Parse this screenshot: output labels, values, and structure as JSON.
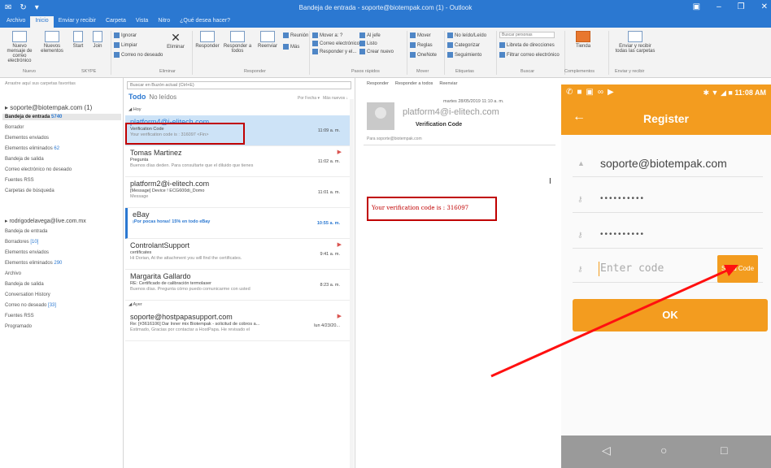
{
  "window": {
    "title": "Bandeja de entrada - soporte@biotempak.com (1) - Outlook",
    "qat_icons": [
      "outlook-icon",
      "send-receive-icon",
      "dropdown-icon"
    ],
    "controls": [
      "ribbon-display-icon",
      "minimize-icon",
      "maximize-icon",
      "close-icon"
    ]
  },
  "tabs": [
    "Archivo",
    "Inicio",
    "Enviar y recibir",
    "Carpeta",
    "Vista",
    "Nitro",
    "¿Qué desea hacer?"
  ],
  "ribbon": {
    "nuevo": {
      "new_email": "Nuevo mensaje de correo electrónico",
      "new_items": "Nuevos elementos",
      "group": "Nuevo"
    },
    "eliminar": {
      "ignore": "Ignorar",
      "clean": "Limpiar",
      "junk": "Correo no deseado",
      "delete": "Eliminar",
      "group": "Eliminar"
    },
    "skype": {
      "start": "Start",
      "join": "Join",
      "group": "SKYPE"
    },
    "responder": {
      "reply": "Responder",
      "reply_all": "Responder a todos",
      "forward": "Reenviar",
      "meeting": "Reunión",
      "more": "Más",
      "group": "Responder"
    },
    "quick_steps": {
      "move_to": "Mover a: ?",
      "to_manager": "Al jefe",
      "team_email": "Correo electrónico...",
      "done": "Listo",
      "reply_delete": "Responder y el...",
      "create_new": "Crear nuevo",
      "group": "Pasos rápidos"
    },
    "mover": {
      "move": "Mover",
      "rules": "Reglas",
      "onenote": "OneNote",
      "group": "Mover"
    },
    "etiquetas": {
      "unread": "No leído/Leído",
      "categorize": "Categorizar",
      "follow_up": "Seguimiento",
      "group": "Etiquetas"
    },
    "buscar": {
      "search_people_placeholder": "Buscar personas",
      "address_book": "Libreta de direcciones",
      "filter_email": "Filtrar correo electrónico",
      "group": "Buscar"
    },
    "complementos": {
      "store": "Tienda",
      "group": "Complementos"
    },
    "invitar": {
      "send_receive": "Enviar y recibir todas las carpetas",
      "group": "Enviar y recibir"
    }
  },
  "folders": {
    "drag_hint": "Arrastre aquí sus carpetas favoritas",
    "account1": "soporte@biotempak.com (1)",
    "account1_items": [
      {
        "label": "Bandeja de entrada",
        "count": "5740",
        "selected": true
      },
      {
        "label": "Borrador",
        "count": ""
      },
      {
        "label": "Elementos enviados",
        "count": ""
      },
      {
        "label": "Elementos eliminados",
        "count": "62"
      },
      {
        "label": "Bandeja de salida",
        "count": ""
      },
      {
        "label": "Correo electrónico no deseado",
        "count": ""
      },
      {
        "label": "Fuentes RSS",
        "count": ""
      },
      {
        "label": "Carpetas de búsqueda",
        "count": ""
      }
    ],
    "account2": "rodrigodelavega@live.com.mx",
    "account2_items": [
      {
        "label": "Bandeja de entrada",
        "count": ""
      },
      {
        "label": "Borradores",
        "count": "[10]"
      },
      {
        "label": "Elementos enviados",
        "count": ""
      },
      {
        "label": "Elementos eliminados",
        "count": "290"
      },
      {
        "label": "Archivo",
        "count": ""
      },
      {
        "label": "Bandeja de salida",
        "count": ""
      },
      {
        "label": "Conversation History",
        "count": ""
      },
      {
        "label": "Correo no deseado",
        "count": "[33]"
      },
      {
        "label": "Fuentes RSS",
        "count": ""
      },
      {
        "label": "Programado",
        "count": ""
      }
    ]
  },
  "list": {
    "search_placeholder": "Buscar en Buzón actual (Ctrl+E)",
    "scope": "Buzón actual",
    "filter_all": "Todo",
    "filter_unread": "No leídos",
    "sort": "Por Fecha",
    "order": "Más nuevos",
    "group_today": "Hoy",
    "group_yesterday": "Ayer",
    "messages": [
      {
        "sender": "platform4@i-elitech.com",
        "subject": "Verification Code",
        "preview": "Your verification code is : 316097 <Fin>",
        "time": "11:09 a. m.",
        "flag": ""
      },
      {
        "sender": "Tomas Martinez",
        "subject": "Pregunta",
        "preview": "Buenos días deden. Para consultarte que el diluido que tienes",
        "time": "11:02 a. m.",
        "flag": "▶"
      },
      {
        "sender": "platform2@i-elitech.com",
        "subject": "[Message] Device ! ECG600di_Domo",
        "preview": "Message",
        "time": "11:01 a. m.",
        "flag": ""
      },
      {
        "sender": "eBay",
        "subject": "¡Por pocas horas! 15% en todo eBay",
        "preview": "",
        "time": "10:55 a. m.",
        "flag": ""
      },
      {
        "sender": "ControlantSupport",
        "subject": "certificates",
        "preview": "Hi Dorian, At the attachment you will find the certificates.",
        "time": "9:41 a. m.",
        "flag": "▶"
      },
      {
        "sender": "Margarita Gallardo",
        "subject": "RE: Certificado de calibración termolaser",
        "preview": "Buenos días. Pregunta cómo puedo comunicarme con usted",
        "time": "8:23 a. m.",
        "flag": ""
      },
      {
        "sender": "soporte@hostpapasupport.com",
        "subject": "Re: [#3616106] Dar Inner mix Biotempak - solicitud de cobros a...",
        "preview": "Estimado, Gracias por contactar a HostPapa. He revisado el",
        "time": "lun 4/23/20...",
        "flag": "▶"
      }
    ]
  },
  "reading": {
    "actions": [
      "Responder",
      "Responder a todos",
      "Reenviar"
    ],
    "date": "martes 28/05/2019 11:10 a. m.",
    "from": "platform4@i-elitech.com",
    "subject": "Verification Code",
    "to": "Para   soporte@biotempak.com",
    "body": "Your verification code is : 316097"
  },
  "phone": {
    "time": "11:08 AM",
    "title": "Register",
    "email": "soporte@biotempak.com",
    "password": "••••••••••",
    "confirm_password": "••••••••••",
    "code_placeholder": "Enter code",
    "send_code": "Send Code",
    "ok": "OK",
    "nav": [
      "◁",
      "○",
      "□"
    ]
  },
  "colors": {
    "outlook_blue": "#2b78d1",
    "phone_orange": "#f39c1f",
    "annotation_red": "#c00000",
    "arrow_red": "#ff1010"
  }
}
